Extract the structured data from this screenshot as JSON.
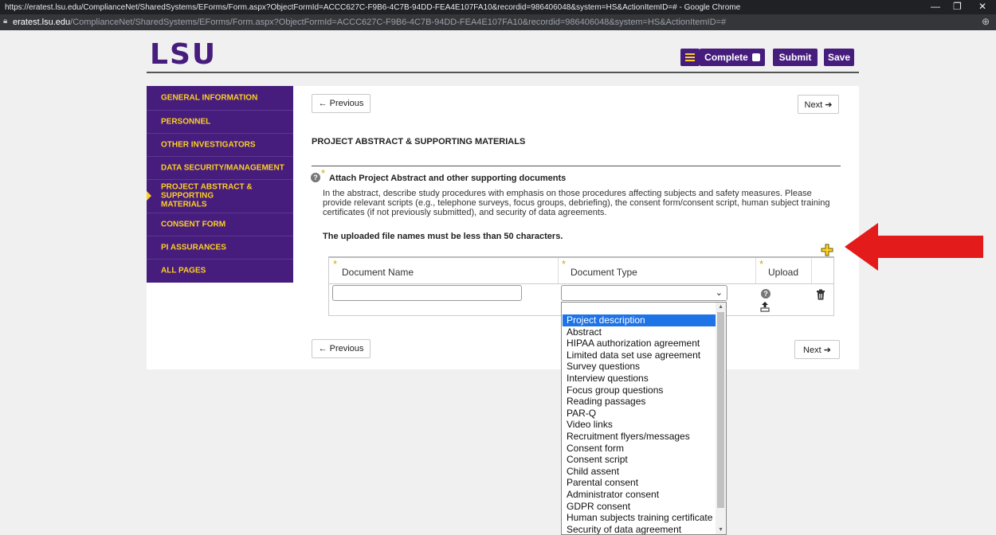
{
  "browser": {
    "title": "https://eratest.lsu.edu/ComplianceNet/SharedSystems/EForms/Form.aspx?ObjectFormId=ACCC627C-F9B6-4C7B-94DD-FEA4E107FA10&recordid=986406048&system=HS&ActionItemID=# - Google Chrome",
    "host": "eratest.lsu.edu",
    "path": "/ComplianceNet/SharedSystems/EForms/Form.aspx?ObjectFormId=ACCC627C-F9B6-4C7B-94DD-FEA4E107FA10&recordid=986406048&system=HS&ActionItemID=#",
    "minimize": "—",
    "restore": "❐",
    "close": "✕",
    "zoom": "⊕"
  },
  "header": {
    "logo_text": "LSU",
    "complete_label": "Complete",
    "submit_label": "Submit",
    "save_label": "Save",
    "brand_color": "#461d7c",
    "accent_color": "#fdd023"
  },
  "sidebar": {
    "items": [
      {
        "label": "GENERAL INFORMATION"
      },
      {
        "label": "PERSONNEL"
      },
      {
        "label": "OTHER INVESTIGATORS"
      },
      {
        "label": "DATA SECURITY/MANAGEMENT"
      },
      {
        "label": "PROJECT ABSTRACT & SUPPORTING MATERIALS",
        "active": true
      },
      {
        "label": "CONSENT FORM"
      },
      {
        "label": "PI ASSURANCES"
      },
      {
        "label": "ALL PAGES"
      }
    ]
  },
  "nav": {
    "previous": "← Previous",
    "next": "Next ➔"
  },
  "section": {
    "title": "PROJECT ABSTRACT & SUPPORTING MATERIALS",
    "attach_label": "Attach Project Abstract and other supporting documents",
    "description": "In the abstract, describe study procedures with emphasis on those procedures affecting subjects and safety measures. Please provide relevant scripts (e.g., telephone surveys, focus groups, debriefing), the consent form/consent script, human subject training certificates (if not previously submitted), and security of data agreements.",
    "warning": "The uploaded file names must be less than 50 characters.",
    "help": "?",
    "required": "*"
  },
  "table": {
    "columns": [
      "Document Name",
      "Document Type",
      "Upload"
    ],
    "row": {
      "document_name": "",
      "document_type": ""
    }
  },
  "dropdown": {
    "selected": "Project description",
    "options": [
      "Project description",
      "Abstract",
      "HIPAA authorization agreement",
      "Limited data set use agreement",
      "Survey questions",
      "Interview questions",
      "Focus group questions",
      "Reading passages",
      "PAR-Q",
      "Video links",
      "Recruitment flyers/messages",
      "Consent form",
      "Consent script",
      "Child assent",
      "Parental consent",
      "Administrator consent",
      "GDPR consent",
      "Human subjects training certificate",
      "Security of data agreement"
    ],
    "highlight_color": "#1e74e6"
  },
  "annotation": {
    "arrow_color": "#e31b1b"
  }
}
